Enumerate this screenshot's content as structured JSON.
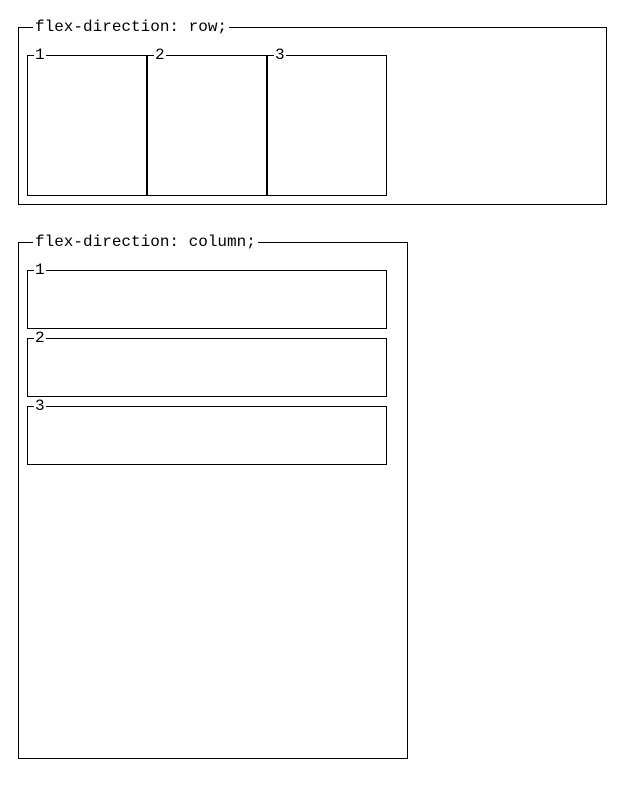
{
  "row_example": {
    "label": "flex-direction: row;",
    "items": [
      {
        "label": "1"
      },
      {
        "label": "2"
      },
      {
        "label": "3"
      }
    ]
  },
  "column_example": {
    "label": "flex-direction: column;",
    "items": [
      {
        "label": "1"
      },
      {
        "label": "2"
      },
      {
        "label": "3"
      }
    ]
  }
}
